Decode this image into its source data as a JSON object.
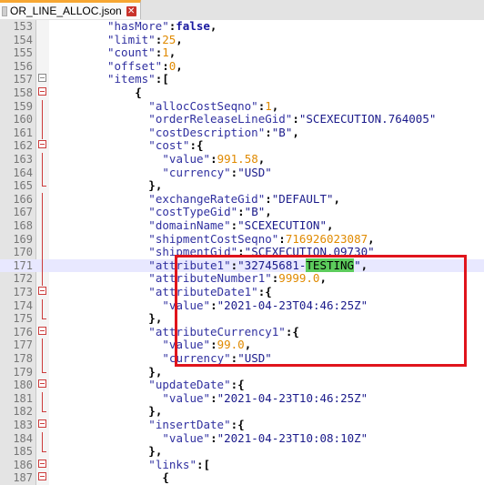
{
  "tab": {
    "filename": "OR_LINE_ALLOC.json",
    "close_glyph": "✕"
  },
  "lines": [
    {
      "num": "153",
      "indent": 16,
      "parts": [
        [
          "k",
          "\"hasMore\""
        ],
        [
          "p",
          ":"
        ],
        [
          "b",
          "false"
        ],
        [
          "p",
          ","
        ]
      ]
    },
    {
      "num": "154",
      "indent": 16,
      "parts": [
        [
          "k",
          "\"limit\""
        ],
        [
          "p",
          ":"
        ],
        [
          "n",
          "25"
        ],
        [
          "p",
          ","
        ]
      ]
    },
    {
      "num": "155",
      "indent": 16,
      "parts": [
        [
          "k",
          "\"count\""
        ],
        [
          "p",
          ":"
        ],
        [
          "n",
          "1"
        ],
        [
          "p",
          ","
        ]
      ]
    },
    {
      "num": "156",
      "indent": 16,
      "parts": [
        [
          "k",
          "\"offset\""
        ],
        [
          "p",
          ":"
        ],
        [
          "n",
          "0"
        ],
        [
          "p",
          ","
        ]
      ]
    },
    {
      "num": "157",
      "indent": 16,
      "parts": [
        [
          "k",
          "\"items\""
        ],
        [
          "p",
          ":["
        ]
      ]
    },
    {
      "num": "158",
      "indent": 20,
      "parts": [
        [
          "p",
          "{"
        ]
      ]
    },
    {
      "num": "159",
      "indent": 22,
      "parts": [
        [
          "k",
          "\"allocCostSeqno\""
        ],
        [
          "p",
          ":"
        ],
        [
          "n",
          "1"
        ],
        [
          "p",
          ","
        ]
      ]
    },
    {
      "num": "160",
      "indent": 22,
      "parts": [
        [
          "k",
          "\"orderReleaseLineGid\""
        ],
        [
          "p",
          ":"
        ],
        [
          "s",
          "\"SCEXECUTION.764005\""
        ]
      ]
    },
    {
      "num": "161",
      "indent": 22,
      "parts": [
        [
          "k",
          "\"costDescription\""
        ],
        [
          "p",
          ":"
        ],
        [
          "s",
          "\"B\""
        ],
        [
          "p",
          ","
        ]
      ]
    },
    {
      "num": "162",
      "indent": 22,
      "parts": [
        [
          "k",
          "\"cost\""
        ],
        [
          "p",
          ":{"
        ]
      ]
    },
    {
      "num": "163",
      "indent": 24,
      "parts": [
        [
          "k",
          "\"value\""
        ],
        [
          "p",
          ":"
        ],
        [
          "n",
          "991.58"
        ],
        [
          "p",
          ","
        ]
      ]
    },
    {
      "num": "164",
      "indent": 24,
      "parts": [
        [
          "k",
          "\"currency\""
        ],
        [
          "p",
          ":"
        ],
        [
          "s",
          "\"USD\""
        ]
      ]
    },
    {
      "num": "165",
      "indent": 22,
      "parts": [
        [
          "p",
          "},"
        ]
      ]
    },
    {
      "num": "166",
      "indent": 22,
      "parts": [
        [
          "k",
          "\"exchangeRateGid\""
        ],
        [
          "p",
          ":"
        ],
        [
          "s",
          "\"DEFAULT\""
        ],
        [
          "p",
          ","
        ]
      ]
    },
    {
      "num": "167",
      "indent": 22,
      "parts": [
        [
          "k",
          "\"costTypeGid\""
        ],
        [
          "p",
          ":"
        ],
        [
          "s",
          "\"B\""
        ],
        [
          "p",
          ","
        ]
      ]
    },
    {
      "num": "168",
      "indent": 22,
      "parts": [
        [
          "k",
          "\"domainName\""
        ],
        [
          "p",
          ":"
        ],
        [
          "s",
          "\"SCEXECUTION\""
        ],
        [
          "p",
          ","
        ]
      ]
    },
    {
      "num": "169",
      "indent": 22,
      "parts": [
        [
          "k",
          "\"shipmentCostSeqno\""
        ],
        [
          "p",
          ":"
        ],
        [
          "n",
          "716926023087"
        ],
        [
          "p",
          ","
        ]
      ]
    },
    {
      "num": "170",
      "indent": 22,
      "parts": [
        [
          "k",
          "\"shipmentGid\""
        ],
        [
          "p",
          ":"
        ],
        [
          "s",
          "\"SCEXECUTION.09730\""
        ]
      ]
    },
    {
      "num": "171",
      "indent": 22,
      "current": true,
      "parts": [
        [
          "k",
          "\"attribute1\""
        ],
        [
          "p",
          ":"
        ],
        [
          "s",
          "\"32745681-"
        ],
        [
          "hl",
          "TESTING"
        ],
        [
          "s",
          "\""
        ],
        [
          "p",
          ","
        ]
      ]
    },
    {
      "num": "172",
      "indent": 22,
      "parts": [
        [
          "k",
          "\"attributeNumber1\""
        ],
        [
          "p",
          ":"
        ],
        [
          "n",
          "9999.0"
        ],
        [
          "p",
          ","
        ]
      ]
    },
    {
      "num": "173",
      "indent": 22,
      "parts": [
        [
          "k",
          "\"attributeDate1\""
        ],
        [
          "p",
          ":{"
        ]
      ]
    },
    {
      "num": "174",
      "indent": 24,
      "parts": [
        [
          "k",
          "\"value\""
        ],
        [
          "p",
          ":"
        ],
        [
          "s",
          "\"2021-04-23T04:46:25Z\""
        ]
      ]
    },
    {
      "num": "175",
      "indent": 22,
      "parts": [
        [
          "p",
          "},"
        ]
      ]
    },
    {
      "num": "176",
      "indent": 22,
      "parts": [
        [
          "k",
          "\"attributeCurrency1\""
        ],
        [
          "p",
          ":{"
        ]
      ]
    },
    {
      "num": "177",
      "indent": 24,
      "parts": [
        [
          "k",
          "\"value\""
        ],
        [
          "p",
          ":"
        ],
        [
          "n",
          "99.0"
        ],
        [
          "p",
          ","
        ]
      ]
    },
    {
      "num": "178",
      "indent": 24,
      "parts": [
        [
          "k",
          "\"currency\""
        ],
        [
          "p",
          ":"
        ],
        [
          "s",
          "\"USD\""
        ]
      ]
    },
    {
      "num": "179",
      "indent": 22,
      "parts": [
        [
          "p",
          "},"
        ]
      ]
    },
    {
      "num": "180",
      "indent": 22,
      "parts": [
        [
          "k",
          "\"updateDate\""
        ],
        [
          "p",
          ":{"
        ]
      ]
    },
    {
      "num": "181",
      "indent": 24,
      "parts": [
        [
          "k",
          "\"value\""
        ],
        [
          "p",
          ":"
        ],
        [
          "s",
          "\"2021-04-23T10:46:25Z\""
        ]
      ]
    },
    {
      "num": "182",
      "indent": 22,
      "parts": [
        [
          "p",
          "},"
        ]
      ]
    },
    {
      "num": "183",
      "indent": 22,
      "parts": [
        [
          "k",
          "\"insertDate\""
        ],
        [
          "p",
          ":{"
        ]
      ]
    },
    {
      "num": "184",
      "indent": 24,
      "parts": [
        [
          "k",
          "\"value\""
        ],
        [
          "p",
          ":"
        ],
        [
          "s",
          "\"2021-04-23T10:08:10Z\""
        ]
      ]
    },
    {
      "num": "185",
      "indent": 22,
      "parts": [
        [
          "p",
          "},"
        ]
      ]
    },
    {
      "num": "186",
      "indent": 22,
      "parts": [
        [
          "k",
          "\"links\""
        ],
        [
          "p",
          ":["
        ]
      ]
    },
    {
      "num": "187",
      "indent": 24,
      "parts": [
        [
          "p",
          "{"
        ]
      ]
    }
  ],
  "fold_markers": {
    "157": "box-grey",
    "158": "box",
    "162": "box",
    "165": "end",
    "173": "box",
    "175": "end",
    "176": "box",
    "179": "end",
    "180": "box",
    "182": "end",
    "183": "box",
    "185": "end",
    "186": "box",
    "187": "box"
  },
  "colors": {
    "highlight_box": "#e0141c",
    "search_highlight": "#5ccc5c",
    "tab_accent": "#f7a733"
  }
}
